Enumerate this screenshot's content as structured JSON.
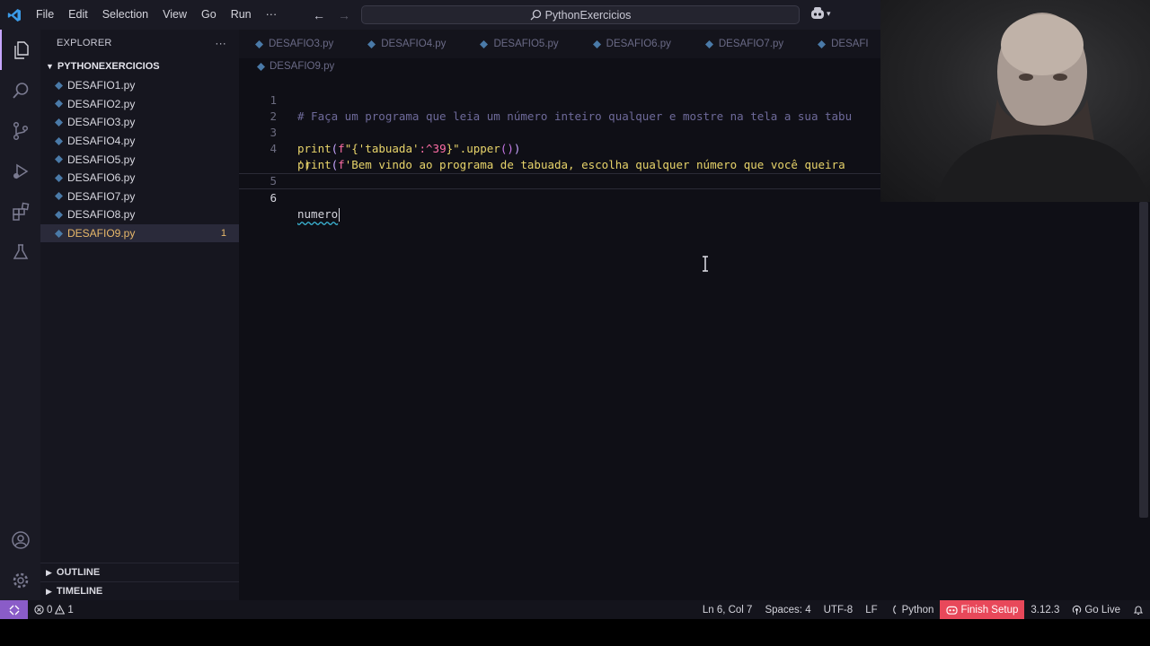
{
  "menu": [
    "File",
    "Edit",
    "Selection",
    "View",
    "Go",
    "Run",
    "···"
  ],
  "search": {
    "label": "PythonExercicios"
  },
  "explorer": {
    "title": "EXPLORER",
    "more": "···",
    "folder": "PYTHONEXERCICIOS",
    "files": [
      {
        "name": "DESAFIO1.py"
      },
      {
        "name": "DESAFIO2.py"
      },
      {
        "name": "DESAFIO3.py"
      },
      {
        "name": "DESAFIO4.py"
      },
      {
        "name": "DESAFIO5.py"
      },
      {
        "name": "DESAFIO6.py"
      },
      {
        "name": "DESAFIO7.py"
      },
      {
        "name": "DESAFIO8.py"
      },
      {
        "name": "DESAFIO9.py",
        "badge": "1",
        "active": true
      }
    ],
    "outline": "OUTLINE",
    "timeline": "TIMELINE"
  },
  "tabs": [
    "DESAFIO3.py",
    "DESAFIO4.py",
    "DESAFIO5.py",
    "DESAFIO6.py",
    "DESAFIO7.py",
    "DESAFI"
  ],
  "breadcrumb": "DESAFIO9.py",
  "code": {
    "line1": "# Faça um programa que leia um número inteiro qualquer e mostre na tela a sua tabu",
    "line3_fn": "print",
    "line3_fmt": "f",
    "line3_q1": "\"{",
    "line3_s": "'tabuada'",
    "line3_spec": ":^39",
    "line3_q2": "}\"",
    "line3_m": ".upper",
    "line4_fn": "print",
    "line4_fmt": "f",
    "line4_s": "'Bem vindo ao programa de tabuada, escolha qualquer número que você queira",
    "line4b": "')",
    "line6": "numero",
    "numbers": [
      "1",
      "2",
      "3",
      "4",
      "5",
      "6"
    ]
  },
  "status": {
    "errors": "0",
    "warnings": "1",
    "position": "Ln 6, Col 7",
    "spaces": "Spaces: 4",
    "encoding": "UTF-8",
    "eol": "LF",
    "language": "Python",
    "finish": "Finish Setup",
    "version": "3.12.3",
    "golive": "Go Live"
  },
  "colors": {
    "accent": "#c7a6ff",
    "finish": "#e8485a",
    "remote": "#8a5cc8",
    "modified": "#e8b86a"
  }
}
